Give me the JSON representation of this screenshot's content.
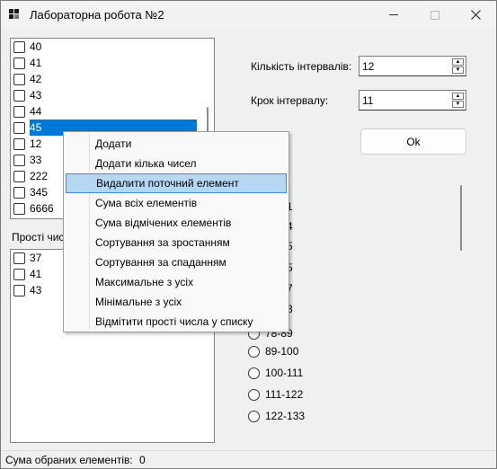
{
  "window": {
    "title": "Лабораторна робота №2"
  },
  "numbers_list": {
    "items": [
      "40",
      "41",
      "42",
      "43",
      "44",
      "45",
      "12",
      "33",
      "222",
      "345",
      "6666"
    ],
    "selected": "45"
  },
  "primes_section": {
    "label": "Прості чис",
    "items": [
      "37",
      "41",
      "43"
    ]
  },
  "controls": {
    "intervals_label": "Кількість інтервалів:",
    "intervals_value": "12",
    "step_label": "Крок інтервалу:",
    "step_value": "11",
    "ok_label": "Ok"
  },
  "intervals": {
    "partial_labels": [
      "1",
      "4",
      "5",
      "5",
      "7",
      "3",
      "78-89"
    ],
    "visible": [
      "89-100",
      "100-111",
      "111-122",
      "122-133"
    ]
  },
  "context_menu": {
    "items": [
      "Додати",
      "Додати кілька чисел",
      "Видалити поточний елемент",
      "Сума всіх елементів",
      "Сума відмічених елементів",
      "Сортування за зростанням",
      "Сортування за спаданням",
      "Максимальне з усіх",
      "Мінімальне з усіх",
      "Відмітити прості числа у списку"
    ],
    "highlighted": "Видалити поточний елемент"
  },
  "status": {
    "label": "Сума обраних елементів:",
    "value": "0"
  }
}
